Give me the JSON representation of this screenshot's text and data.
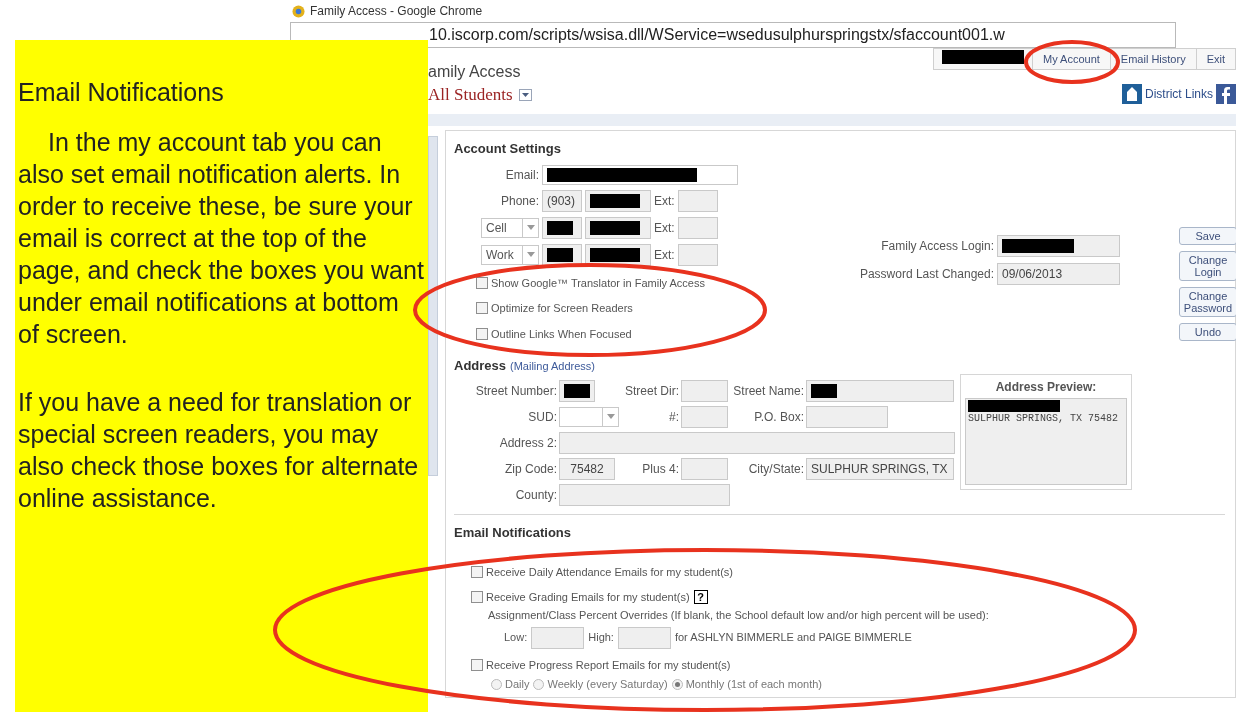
{
  "browser": {
    "title": "Family Access - Google Chrome",
    "url": "10.iscorp.com/scripts/wsisa.dll/WService=wsedusulphurspringstx/sfaccount001.w"
  },
  "header": {
    "app_title": "amily Access",
    "student_selector": "All Students",
    "top_links": [
      {
        "label": "My Account"
      },
      {
        "label": "Email History"
      },
      {
        "label": "Exit"
      }
    ],
    "district_links": "District Links"
  },
  "account_settings": {
    "title": "Account Settings",
    "email_label": "Email:",
    "phones": [
      {
        "kind": "fixed",
        "label": "Phone:",
        "area": "(903)",
        "ext_label": "Ext:"
      },
      {
        "kind": "select",
        "label": "Cell",
        "ext_label": "Ext:"
      },
      {
        "kind": "select",
        "label": "Work",
        "ext_label": "Ext:"
      }
    ],
    "options": [
      {
        "label": "Show Google™ Translator in Family Access",
        "checked": false
      },
      {
        "label": "Optimize for Screen Readers",
        "checked": false
      },
      {
        "label": "Outline Links When Focused",
        "checked": false
      }
    ],
    "login_label": "Family Access Login:",
    "password_label": "Password Last Changed:",
    "password_value": "09/06/2013",
    "buttons": [
      "Save",
      "Change Login",
      "Change Password",
      "Undo"
    ]
  },
  "address": {
    "title": "Address",
    "subtitle": "(Mailing Address)",
    "fields": [
      {
        "kind": "short",
        "label": "Street Number:",
        "redacted": true
      },
      {
        "kind": "medium",
        "label": "Street Dir:",
        "redacted": false
      },
      {
        "kind": "long",
        "label": "Street Name:",
        "redacted": true
      },
      {
        "kind": "select",
        "label": "SUD:",
        "redacted": false
      },
      {
        "kind": "medium",
        "label": "#:",
        "redacted": false
      },
      {
        "kind": "pobox",
        "label": "P.O. Box:",
        "redacted": false
      },
      {
        "kind": "wide",
        "label": "Address 2:",
        "redacted": false
      },
      {
        "kind": "zip",
        "label": "Zip Code:",
        "value": "75482",
        "redacted": false
      },
      {
        "kind": "medium",
        "label": "Plus 4:",
        "redacted": false
      },
      {
        "kind": "long",
        "label": "City/State:",
        "value": "SULPHUR SPRINGS, TX",
        "redacted": false
      },
      {
        "kind": "half",
        "label": "County:",
        "redacted": false
      }
    ],
    "preview_title": "Address Preview:",
    "preview_lines": [
      {
        "redacted": true
      },
      {
        "text": "SULPHUR SPRINGS, TX 75482",
        "redacted": false
      }
    ]
  },
  "email_notifications": {
    "title": "Email Notifications",
    "attendance": {
      "label": "Receive Daily Attendance Emails for my student(s)",
      "checked": false
    },
    "grading": {
      "label": "Receive Grading Emails for my student(s)",
      "help": "?",
      "checked": false,
      "override_note": "Assignment/Class Percent Overrides (If blank, the School default low and/or high percent will be used):",
      "low_label": "Low:",
      "high_label": "High:",
      "students": "for ASHLYN BIMMERLE and PAIGE BIMMERLE"
    },
    "progress": {
      "label": "Receive Progress Report Emails for my student(s)",
      "checked": false,
      "frequencies": [
        {
          "label": "Daily",
          "selected": false
        },
        {
          "label": "Weekly (every Saturday)",
          "selected": false
        },
        {
          "label": "Monthly (1st of each month)",
          "selected": true
        }
      ]
    }
  },
  "note": {
    "title": "Email Notifications",
    "paragraphs": [
      "In the my account tab you can also set email notification alerts.  In order to receive these, be sure your email is correct at the top of the page, and check the boxes you want under email notifications at bottom of screen.",
      "If you have a need for translation or special screen readers, you may also check those boxes for alternate online assistance."
    ]
  }
}
